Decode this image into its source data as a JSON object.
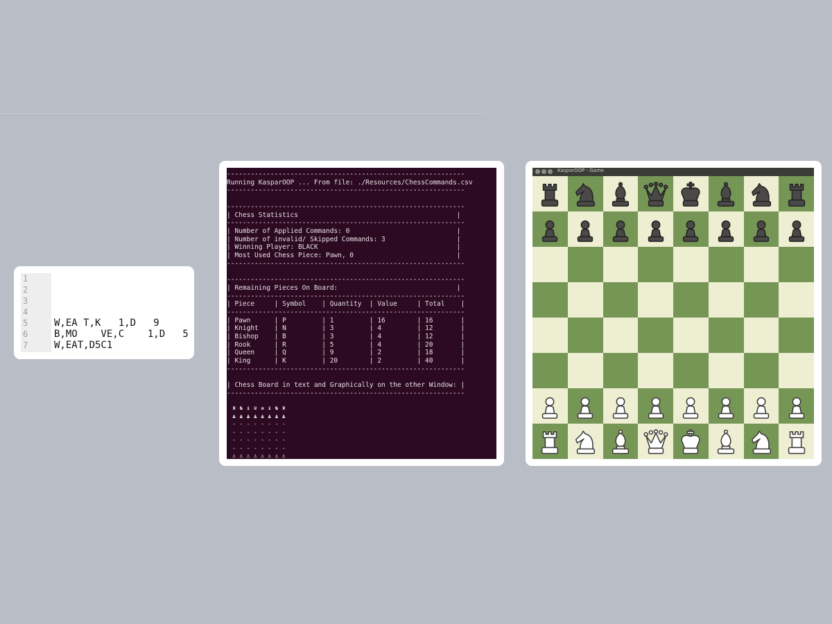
{
  "csv_editor": {
    "line_numbers": [
      "1",
      "2",
      "3",
      "4",
      "5",
      "6",
      "7"
    ],
    "lines": [
      "",
      "",
      "",
      "",
      "W,EA T,K   1,D   9",
      "B,MO    VE,C    1,D   5",
      "W,EAT,D5C1"
    ]
  },
  "terminal": {
    "lines": [
      "------------------------------------------------------------",
      "Running KasparOOP ... From file: ./Resources/ChessCommands.csv",
      "------------------------------------------------------------",
      "",
      "------------------------------------------------------------",
      "| Chess Statistics                                        |",
      "------------------------------------------------------------",
      "| Number of Applied Commands: 0                           |",
      "| Number of invalid/ Skipped Commands: 3                  |",
      "| Winning Player: BLACK                                   |",
      "| Most Used Chess Piece: Pawn, 0                          |",
      "------------------------------------------------------------",
      "",
      "------------------------------------------------------------",
      "| Remaining Pieces On Board:                              |",
      "------------------------------------------------------------",
      "| Piece     | Symbol    | Quantity  | Value     | Total    |",
      "------------------------------------------------------------",
      "| Pawn      | P         | 1         | 16        | 16       |",
      "| Knight    | N         | 3         | 4         | 12       |",
      "| Bishop    | B         | 3         | 4         | 12       |",
      "| Rook      | R         | 5         | 4         | 20       |",
      "| Queen     | Q         | 9         | 2         | 18       |",
      "| King      | K         | 20        | 2         | 40       |",
      "------------------------------------------------------------",
      "",
      "| Chess Board in text and Graphically on the other Window: |",
      "------------------------------------------------------------",
      ""
    ],
    "board_text": [
      "♜ ♞ ♝ ♛ ♚ ♝ ♞ ♜",
      "♟ ♟ ♟ ♟ ♟ ♟ ♟ ♟",
      "- - - - - - - -",
      "- - - - - - - -",
      "- - - - - - - -",
      "- - - - - - - -",
      "♙ ♙ ♙ ♙ ♙ ♙ ♙ ♙",
      "♖ ♘ ♗ ♕ ♔ ♗ ♘ ♖"
    ]
  },
  "game_window": {
    "title": "KasparOOP - Game",
    "board_colors": {
      "light": "#eeeed2",
      "dark": "#769656"
    },
    "board": [
      [
        "bR",
        "bN",
        "bB",
        "bQ",
        "bK",
        "bB",
        "bN",
        "bR"
      ],
      [
        "bP",
        "bP",
        "bP",
        "bP",
        "bP",
        "bP",
        "bP",
        "bP"
      ],
      [
        "",
        "",
        "",
        "",
        "",
        "",
        "",
        ""
      ],
      [
        "",
        "",
        "",
        "",
        "",
        "",
        "",
        ""
      ],
      [
        "",
        "",
        "",
        "",
        "",
        "",
        "",
        ""
      ],
      [
        "",
        "",
        "",
        "",
        "",
        "",
        "",
        ""
      ],
      [
        "wP",
        "wP",
        "wP",
        "wP",
        "wP",
        "wP",
        "wP",
        "wP"
      ],
      [
        "wR",
        "wN",
        "wB",
        "wQ",
        "wK",
        "wB",
        "wN",
        "wR"
      ]
    ]
  }
}
